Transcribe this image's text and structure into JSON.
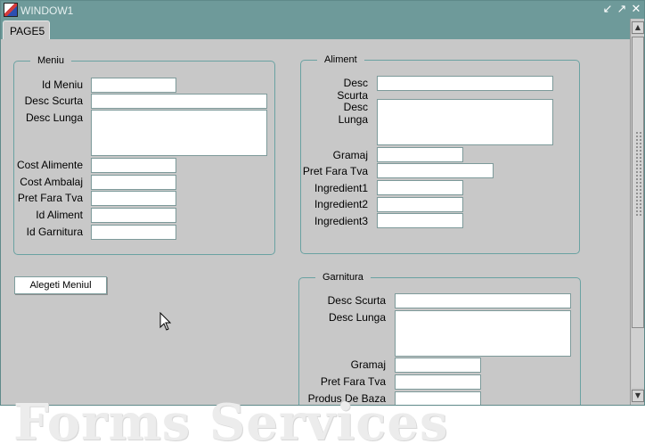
{
  "window": {
    "title": "WINDOW1",
    "tab": "PAGE5"
  },
  "icons": {
    "app": "oracle-forms-icon",
    "minimize": "minimize-icon",
    "maximize": "maximize-icon",
    "close": "close-icon",
    "cursor": "mouse-pointer-icon"
  },
  "meniu": {
    "title": "Meniu",
    "fields": [
      {
        "label": "Id Meniu",
        "value": ""
      },
      {
        "label": "Desc Scurta",
        "value": ""
      },
      {
        "label": "Desc Lunga",
        "value": ""
      },
      {
        "label": "Cost Alimente",
        "value": ""
      },
      {
        "label": "Cost Ambalaj",
        "value": ""
      },
      {
        "label": "Pret Fara Tva",
        "value": ""
      },
      {
        "label": "Id Aliment",
        "value": ""
      },
      {
        "label": "Id Garnitura",
        "value": ""
      }
    ]
  },
  "aliment": {
    "title": "Aliment",
    "fields": [
      {
        "label": "Desc Scurta",
        "value": ""
      },
      {
        "label": "Desc Lunga",
        "value": ""
      },
      {
        "label": "Gramaj",
        "value": ""
      },
      {
        "label": "Pret Fara Tva",
        "value": ""
      },
      {
        "label": "Ingredient1",
        "value": ""
      },
      {
        "label": "Ingredient2",
        "value": ""
      },
      {
        "label": "Ingredient3",
        "value": ""
      }
    ]
  },
  "garnitura": {
    "title": "Garnitura",
    "fields": [
      {
        "label": "Desc Scurta",
        "value": ""
      },
      {
        "label": "Desc Lunga",
        "value": ""
      },
      {
        "label": "Gramaj",
        "value": ""
      },
      {
        "label": "Pret Fara Tva",
        "value": ""
      },
      {
        "label": "Produs De Baza",
        "value": ""
      }
    ]
  },
  "actions": {
    "choose_menu": "Alegeti Meniul"
  },
  "watermark": "Forms Services"
}
